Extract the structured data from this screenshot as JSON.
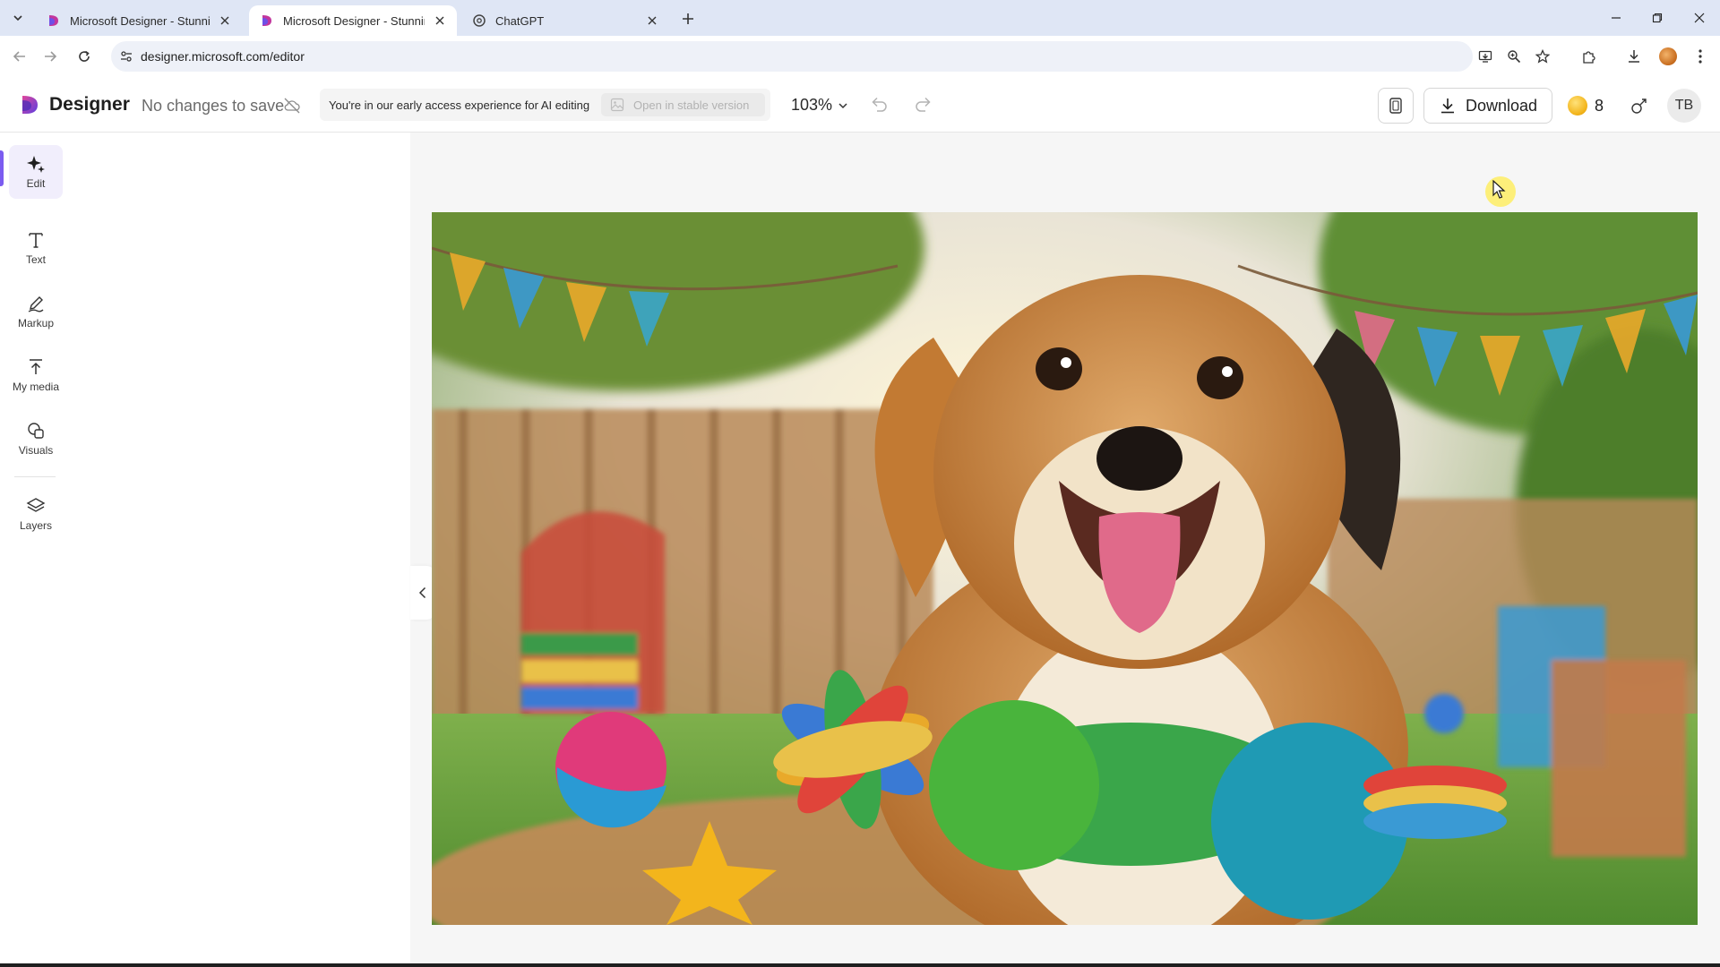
{
  "browser": {
    "tabs": [
      {
        "title": "Microsoft Designer - Stunning",
        "active": false
      },
      {
        "title": "Microsoft Designer - Stunning",
        "active": true
      },
      {
        "title": "ChatGPT",
        "active": false
      }
    ],
    "url": "designer.microsoft.com/editor"
  },
  "app": {
    "brand": "Designer",
    "save_status": "No changes to save",
    "notice": "You're in our early access experience for AI editing",
    "stable_version_label": "Open in stable version",
    "zoom": "103%",
    "download_label": "Download",
    "credits": "8",
    "user_initials": "TB"
  },
  "rail": {
    "items": [
      {
        "label": "Edit",
        "icon": "sparkle-icon",
        "active": true
      },
      {
        "label": "Text",
        "icon": "text-icon",
        "active": false
      },
      {
        "label": "Markup",
        "icon": "pen-icon",
        "active": false
      },
      {
        "label": "My media",
        "icon": "upload-icon",
        "active": false
      },
      {
        "label": "Visuals",
        "icon": "shapes-icon",
        "active": false
      },
      {
        "label": "Layers",
        "icon": "layers-icon",
        "active": false
      }
    ]
  },
  "colors": {
    "accent": "#7b5cf0",
    "tabbar": "#dfe6f5",
    "canvas_bg": "#f6f6f6"
  }
}
